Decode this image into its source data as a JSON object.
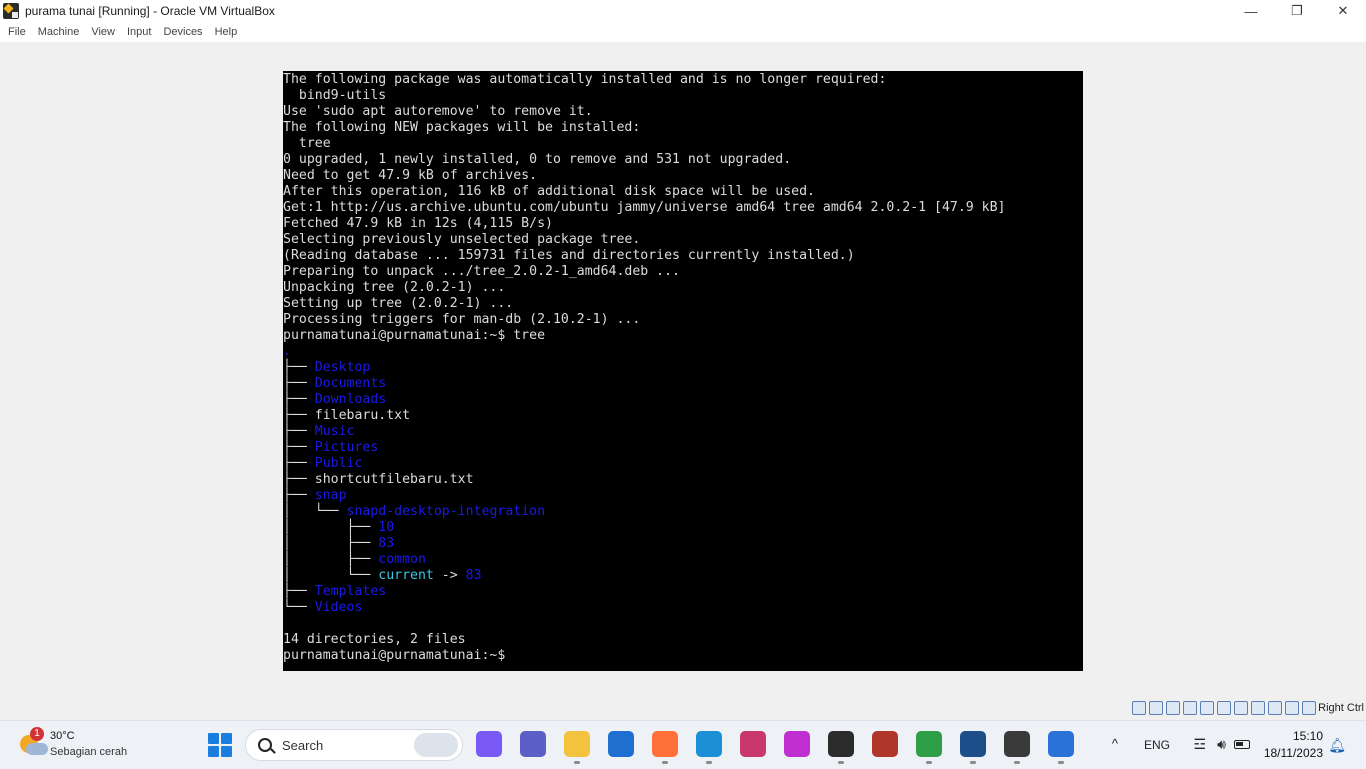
{
  "window": {
    "title": "purama tunai [Running] - Oracle VM VirtualBox",
    "controls": {
      "minimize": "—",
      "maximize": "❐",
      "close": "✕"
    }
  },
  "menu": [
    "File",
    "Machine",
    "View",
    "Input",
    "Devices",
    "Help"
  ],
  "terminal": {
    "lines": [
      [
        {
          "t": "The following package was automatically installed and is no longer required:"
        }
      ],
      [
        {
          "t": "  bind9-utils"
        }
      ],
      [
        {
          "t": "Use 'sudo apt autoremove' to remove it."
        }
      ],
      [
        {
          "t": "The following NEW packages will be installed:"
        }
      ],
      [
        {
          "t": "  tree"
        }
      ],
      [
        {
          "t": "0 upgraded, 1 newly installed, 0 to remove and 531 not upgraded."
        }
      ],
      [
        {
          "t": "Need to get 47.9 kB of archives."
        }
      ],
      [
        {
          "t": "After this operation, 116 kB of additional disk space will be used."
        }
      ],
      [
        {
          "t": "Get:1 http://us.archive.ubuntu.com/ubuntu jammy/universe amd64 tree amd64 2.0.2-1 [47.9 kB]"
        }
      ],
      [
        {
          "t": "Fetched 47.9 kB in 12s (4,115 B/s)"
        }
      ],
      [
        {
          "t": "Selecting previously unselected package tree."
        }
      ],
      [
        {
          "t": "(Reading database ... 159731 files and directories currently installed.)"
        }
      ],
      [
        {
          "t": "Preparing to unpack .../tree_2.0.2-1_amd64.deb ..."
        }
      ],
      [
        {
          "t": "Unpacking tree (2.0.2-1) ..."
        }
      ],
      [
        {
          "t": "Setting up tree (2.0.2-1) ..."
        }
      ],
      [
        {
          "t": "Processing triggers for man-db (2.10.2-1) ..."
        }
      ],
      [
        {
          "t": "purnamatunai@purnamatunai:~$ tree"
        }
      ],
      [
        {
          "t": ".",
          "c": "blue"
        }
      ],
      [
        {
          "t": "├── "
        },
        {
          "t": "Desktop",
          "c": "blue"
        }
      ],
      [
        {
          "t": "├── "
        },
        {
          "t": "Documents",
          "c": "blue"
        }
      ],
      [
        {
          "t": "├── "
        },
        {
          "t": "Downloads",
          "c": "blue"
        }
      ],
      [
        {
          "t": "├── filebaru.txt"
        }
      ],
      [
        {
          "t": "├── "
        },
        {
          "t": "Music",
          "c": "blue"
        }
      ],
      [
        {
          "t": "├── "
        },
        {
          "t": "Pictures",
          "c": "blue"
        }
      ],
      [
        {
          "t": "├── "
        },
        {
          "t": "Public",
          "c": "blue"
        }
      ],
      [
        {
          "t": "├── shortcutfilebaru.txt"
        }
      ],
      [
        {
          "t": "├── "
        },
        {
          "t": "snap",
          "c": "blue"
        }
      ],
      [
        {
          "t": "│   └── "
        },
        {
          "t": "snapd-desktop-integration",
          "c": "blue"
        }
      ],
      [
        {
          "t": "│       ├── "
        },
        {
          "t": "10",
          "c": "blue"
        }
      ],
      [
        {
          "t": "│       ├── "
        },
        {
          "t": "83",
          "c": "blue"
        }
      ],
      [
        {
          "t": "│       ├── "
        },
        {
          "t": "common",
          "c": "blue"
        }
      ],
      [
        {
          "t": "│       └── "
        },
        {
          "t": "current",
          "c": "cyan"
        },
        {
          "t": " -> "
        },
        {
          "t": "83",
          "c": "blue"
        }
      ],
      [
        {
          "t": "├── "
        },
        {
          "t": "Templates",
          "c": "blue"
        }
      ],
      [
        {
          "t": "└── "
        },
        {
          "t": "Videos",
          "c": "blue"
        }
      ],
      [
        {
          "t": ""
        }
      ],
      [
        {
          "t": "14 directories, 2 files"
        }
      ],
      [
        {
          "t": "purnamatunai@purnamatunai:~$"
        }
      ]
    ]
  },
  "vm_status": {
    "host_key": "Right Ctrl"
  },
  "taskbar": {
    "weather": {
      "badge": "1",
      "temp": "30°C",
      "condition": "Sebagian cerah"
    },
    "search_label": "Search",
    "apps": [
      {
        "name": "copilot",
        "color": "#7a5af5",
        "active": false
      },
      {
        "name": "teams",
        "color": "#5b5fc7",
        "active": false
      },
      {
        "name": "file-explorer",
        "color": "#f4c33d",
        "active": true
      },
      {
        "name": "app-blue",
        "color": "#1f6fd1",
        "active": false
      },
      {
        "name": "firefox",
        "color": "#ff7139",
        "active": true
      },
      {
        "name": "edge",
        "color": "#1d8fd6",
        "active": true
      },
      {
        "name": "snipping",
        "color": "#c9376b",
        "active": false
      },
      {
        "name": "wps",
        "color": "#c02fd0",
        "active": false
      },
      {
        "name": "terminal",
        "color": "#2b2b2b",
        "active": true
      },
      {
        "name": "winrar",
        "color": "#b0362c",
        "active": false
      },
      {
        "name": "chrome",
        "color": "#2e9e48",
        "active": true
      },
      {
        "name": "virtualbox",
        "color": "#1c4f8a",
        "active": true
      },
      {
        "name": "app-dark",
        "color": "#3a3a3a",
        "active": true
      },
      {
        "name": "photos",
        "color": "#2a72d8",
        "active": true
      }
    ],
    "tray": {
      "chevron": "^",
      "lang": "ENG",
      "time": "15:10",
      "date": "18/11/2023"
    }
  }
}
